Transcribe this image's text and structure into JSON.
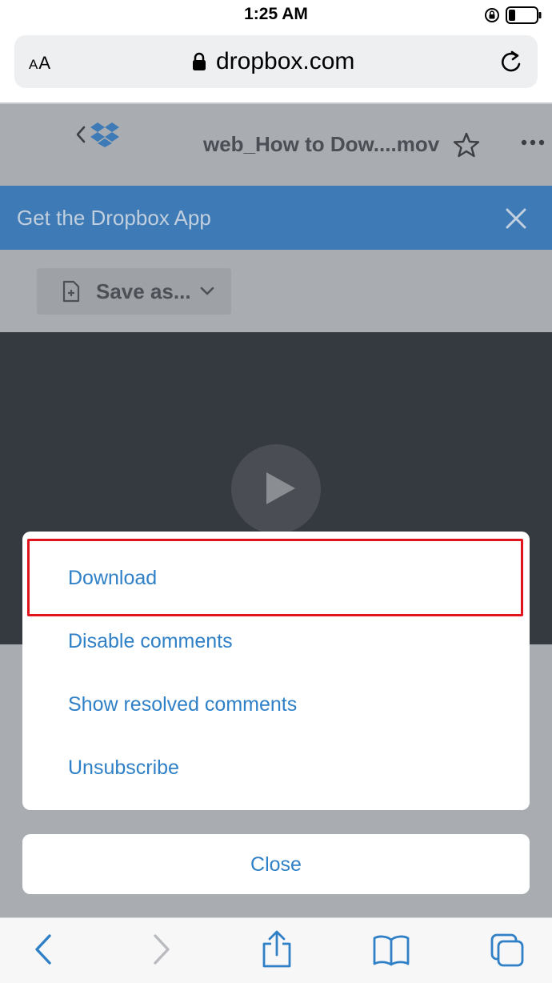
{
  "status_bar": {
    "time": "1:25 AM"
  },
  "browser": {
    "text_size_label_small": "A",
    "text_size_label_large": "A",
    "url": "dropbox.com"
  },
  "page": {
    "file_title": "web_How to Dow....mov",
    "banner_text": "Get the Dropbox App",
    "save_as_label": "Save as..."
  },
  "action_sheet": {
    "items": [
      {
        "label": "Download"
      },
      {
        "label": "Disable comments"
      },
      {
        "label": "Show resolved comments"
      },
      {
        "label": "Unsubscribe"
      }
    ],
    "close_label": "Close"
  },
  "colors": {
    "accent": "#2f80c6",
    "banner": "#3d7ab6",
    "highlight": "#e1131c"
  }
}
